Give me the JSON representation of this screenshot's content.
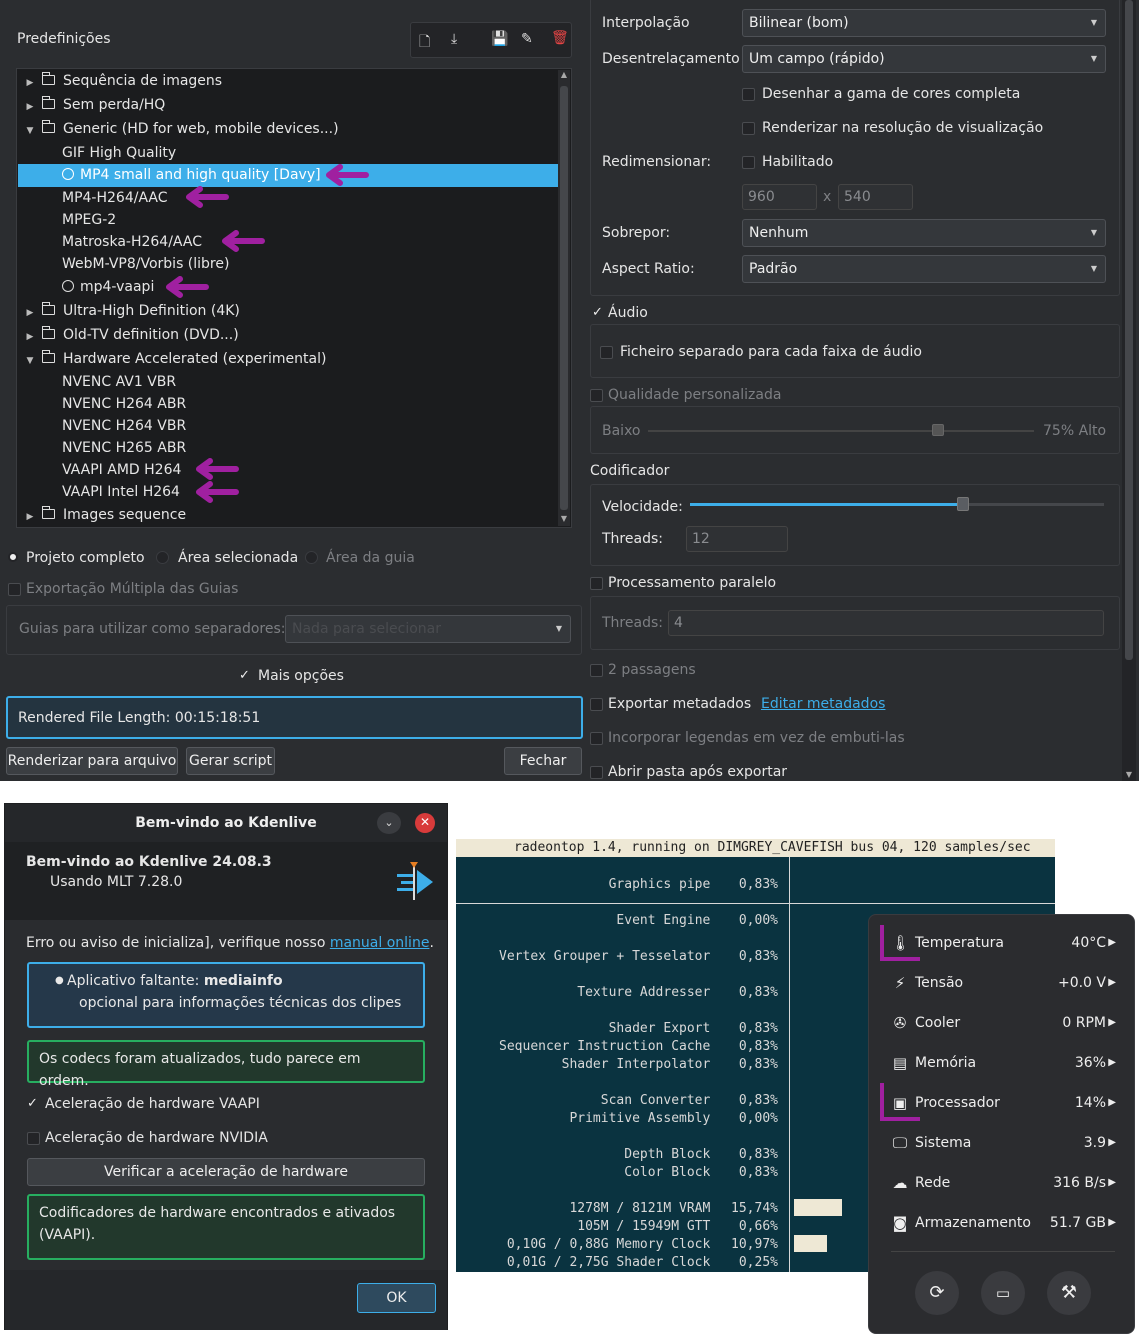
{
  "render": {
    "presets_label": "Predefinições",
    "tree": [
      {
        "label": "Sequência de imagens",
        "type": "folder",
        "expanded": false
      },
      {
        "label": "Sem perda/HQ",
        "type": "folder",
        "expanded": false
      },
      {
        "label": "Generic (HD for web, mobile devices...)",
        "type": "folder",
        "expanded": true
      },
      {
        "label": "GIF High Quality",
        "type": "item"
      },
      {
        "label": "MP4 small and high quality [Davy]",
        "type": "item-globe",
        "selected": true
      },
      {
        "label": "MP4-H264/AAC",
        "type": "item"
      },
      {
        "label": "MPEG-2",
        "type": "item"
      },
      {
        "label": "Matroska-H264/AAC",
        "type": "item"
      },
      {
        "label": "WebM-VP8/Vorbis (libre)",
        "type": "item"
      },
      {
        "label": "mp4-vaapi",
        "type": "item-globe"
      },
      {
        "label": "Ultra-High Definition (4K)",
        "type": "folder",
        "expanded": false
      },
      {
        "label": "Old-TV definition (DVD...)",
        "type": "folder",
        "expanded": false
      },
      {
        "label": "Hardware Accelerated (experimental)",
        "type": "folder",
        "expanded": true
      },
      {
        "label": "NVENC AV1 VBR",
        "type": "item"
      },
      {
        "label": "NVENC H264 ABR",
        "type": "item"
      },
      {
        "label": "NVENC H264 VBR",
        "type": "item"
      },
      {
        "label": "NVENC H265 ABR",
        "type": "item"
      },
      {
        "label": "VAAPI AMD H264",
        "type": "item"
      },
      {
        "label": "VAAPI Intel H264",
        "type": "item"
      },
      {
        "label": "Images sequence",
        "type": "folder",
        "expanded": false
      }
    ],
    "radio_full": "Projeto completo",
    "radio_selected": "Área selecionada",
    "radio_guide": "Área da guia",
    "multi_export": "Exportação Múltipla das Guias",
    "guides_label": "Guias para utilizar como separadores:",
    "guides_placeholder": "Nada para selecionar",
    "more_options": "Mais opções",
    "rendered_length": "Rendered File Length: 00:15:18:51",
    "btn_render": "Renderizar para arquivo",
    "btn_script": "Gerar script",
    "btn_close": "Fechar",
    "interp_label": "Interpolação",
    "interp_value": "Bilinear (bom)",
    "deint_label": "Desentrelaçamento",
    "deint_value": "Um campo (rápido)",
    "full_range": "Desenhar a gama de cores completa",
    "preview_res": "Renderizar na resolução de visualização",
    "resize_label": "Redimensionar:",
    "resize_enabled": "Habilitado",
    "width": "960",
    "height": "540",
    "x_sep": "x",
    "overlay_label": "Sobrepor:",
    "overlay_value": "Nenhum",
    "aspect_label": "Aspect Ratio:",
    "aspect_value": "Padrão",
    "audio": "Áudio",
    "separate_audio": "Ficheiro separado para cada faixa de áudio",
    "custom_quality": "Qualidade personalizada",
    "low": "Baixo",
    "high": "75% Alto",
    "quality_fraction": 0.75,
    "encoder": "Codificador",
    "speed": "Velocidade:",
    "speed_fraction": 0.66,
    "threads_label": "Threads:",
    "threads_value": "12",
    "parallel": "Processamento paralelo",
    "threads2_value": "4",
    "two_pass": "2 passagens",
    "export_meta": "Exportar metadados",
    "edit_meta": "Editar metadados",
    "embed_subs": "Incorporar legendas em vez de embuti-las",
    "open_folder": "Abrir pasta após exportar"
  },
  "welcome": {
    "title": "Bem-vindo ao Kdenlive",
    "heading": "Bem-vindo ao Kdenlive 24.08.3",
    "mlt": "Usando MLT 7.28.0",
    "error_text": "Erro ou aviso de inicializa], verifique nosso ",
    "manual_link": "manual online",
    "missing_prefix": "Aplicativo faltante: ",
    "missing_app": "mediainfo",
    "missing_desc": "opcional para informações técnicas dos clipes",
    "codecs_ok": "Os codecs foram atualizados, tudo parece em ordem.",
    "vaapi": "Aceleração de hardware VAAPI",
    "nvidia": "Aceleração de hardware NVIDIA",
    "check_btn": "Verificar a aceleração de hardware",
    "encoders_found": "Codificadores de hardware encontrados e ativados (VAAPI).",
    "ok": "OK"
  },
  "radeontop": {
    "header": "radeontop 1.4, running on DIMGREY_CAVEFISH bus 04, 120 samples/sec",
    "rows": [
      {
        "name": "Graphics pipe",
        "value": "0,83%"
      },
      {
        "name": "Event Engine",
        "value": "0,00%"
      },
      {
        "name": "Vertex Grouper + Tesselator",
        "value": "0,83%"
      },
      {
        "name": "Texture Addresser",
        "value": "0,83%"
      },
      {
        "name": "Shader Export",
        "value": "0,83%"
      },
      {
        "name": "Sequencer Instruction Cache",
        "value": "0,83%"
      },
      {
        "name": "Shader Interpolator",
        "value": "0,83%"
      },
      {
        "name": "Scan Converter",
        "value": "0,83%"
      },
      {
        "name": "Primitive Assembly",
        "value": "0,00%"
      },
      {
        "name": "Depth Block",
        "value": "0,83%"
      },
      {
        "name": "Color Block",
        "value": "0,83%"
      },
      {
        "name": "1278M / 8121M VRAM",
        "value": "15,74%",
        "bar": 0.1574
      },
      {
        "name": "105M / 15949M GTT",
        "value": "0,66%"
      },
      {
        "name": "0,10G / 0,88G Memory Clock",
        "value": "10,97%",
        "bar": 0.1097
      },
      {
        "name": "0,01G / 2,75G Shader Clock",
        "value": "0,25%"
      }
    ]
  },
  "sysmenu": {
    "items": [
      {
        "icon": "thermometer-icon",
        "glyph": "🌡",
        "name": "Temperatura",
        "value": "40°C"
      },
      {
        "icon": "bolt-icon",
        "glyph": "⚡",
        "name": "Tensão",
        "value": "+0.0 V"
      },
      {
        "icon": "fan-icon",
        "glyph": "✇",
        "name": "Cooler",
        "value": "0 RPM"
      },
      {
        "icon": "memory-icon",
        "glyph": "▤",
        "name": "Memória",
        "value": "36%"
      },
      {
        "icon": "cpu-icon",
        "glyph": "▣",
        "name": "Processador",
        "value": "14%"
      },
      {
        "icon": "monitor-icon",
        "glyph": "🖵",
        "name": "Sistema",
        "value": "3.9"
      },
      {
        "icon": "cloud-icon",
        "glyph": "☁",
        "name": "Rede",
        "value": "316 B/s"
      },
      {
        "icon": "disk-icon",
        "glyph": "◙",
        "name": "Armazenamento",
        "value": "51.7 GB"
      }
    ]
  },
  "colors": {
    "accent": "#3daee9",
    "arrow": "#a020a0",
    "ok_green": "#27ae60",
    "info_blue": "#3daee9"
  }
}
